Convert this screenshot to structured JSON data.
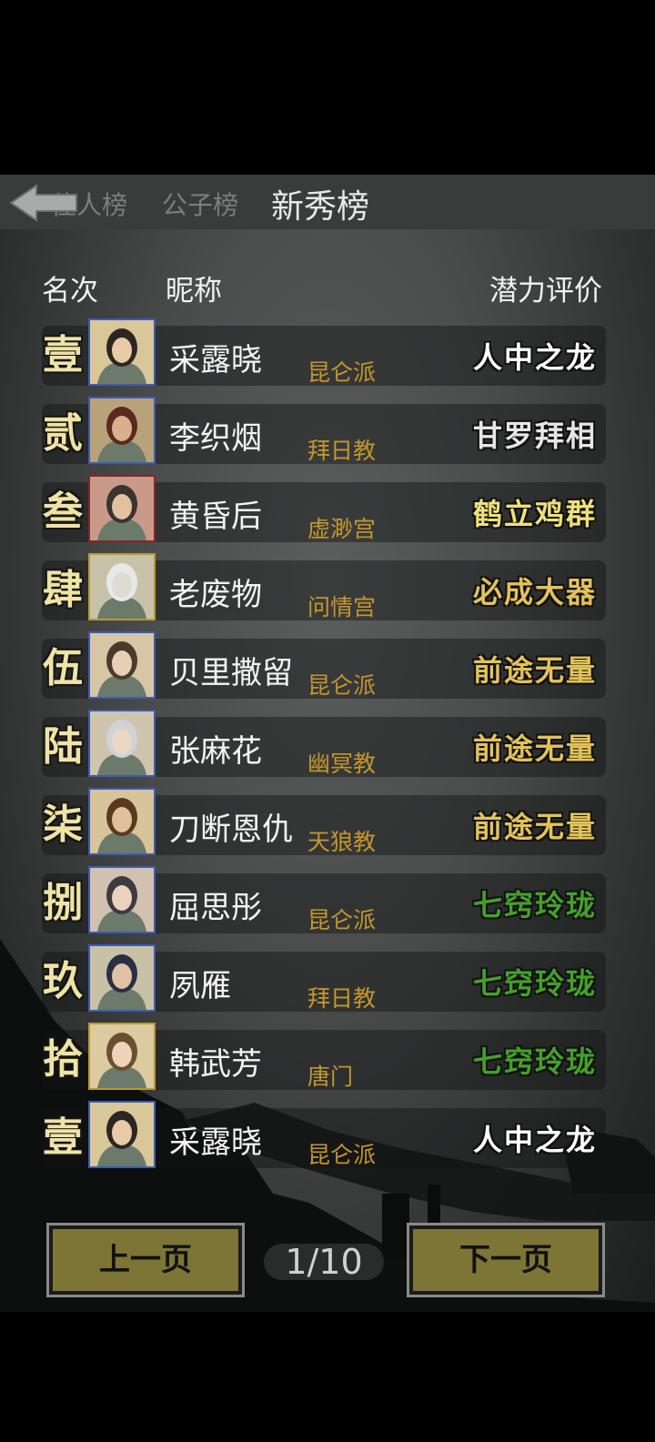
{
  "tabs": [
    {
      "label": "佳人榜"
    },
    {
      "label": "公子榜"
    },
    {
      "label": "新秀榜"
    }
  ],
  "columns": {
    "rank": "名次",
    "nickname": "昵称",
    "potential": "潜力评价"
  },
  "rows": [
    {
      "rank": "壹",
      "name": "采露晓",
      "sect": "昆仑派",
      "evaluation": "人中之龙"
    },
    {
      "rank": "贰",
      "name": "李织烟",
      "sect": "拜日教",
      "evaluation": "甘罗拜相"
    },
    {
      "rank": "叁",
      "name": "黄昏后",
      "sect": "虚渺宫",
      "evaluation": "鹤立鸡群"
    },
    {
      "rank": "肆",
      "name": "老废物",
      "sect": "问情宫",
      "evaluation": "必成大器"
    },
    {
      "rank": "伍",
      "name": "贝里撒留",
      "sect": "昆仑派",
      "evaluation": "前途无量"
    },
    {
      "rank": "陆",
      "name": "张麻花",
      "sect": "幽冥教",
      "evaluation": "前途无量"
    },
    {
      "rank": "柒",
      "name": "刀断恩仇",
      "sect": "天狼教",
      "evaluation": "前途无量"
    },
    {
      "rank": "捌",
      "name": "屈思彤",
      "sect": "昆仑派",
      "evaluation": "七窍玲珑"
    },
    {
      "rank": "玖",
      "name": "夙雁",
      "sect": "拜日教",
      "evaluation": "七窍玲珑"
    },
    {
      "rank": "拾",
      "name": "韩武芳",
      "sect": "唐门",
      "evaluation": "七窍玲珑"
    },
    {
      "rank": "壹",
      "name": "采露晓",
      "sect": "昆仑派",
      "evaluation": "人中之龙"
    }
  ],
  "footer": {
    "prev": "上一页",
    "page": "1/10",
    "next": "下一页"
  },
  "colors": {
    "eval_white": "#ffffff",
    "eval_pale": "#e6e6e6",
    "eval_yellow": "#efe07a",
    "eval_gold": "#e3c25a",
    "eval_green": "#45a02a",
    "sect": "#c5962c",
    "button": "#7c7535"
  },
  "icons": {
    "back": "back-arrow-icon",
    "avatar": "character-portrait-icon"
  }
}
